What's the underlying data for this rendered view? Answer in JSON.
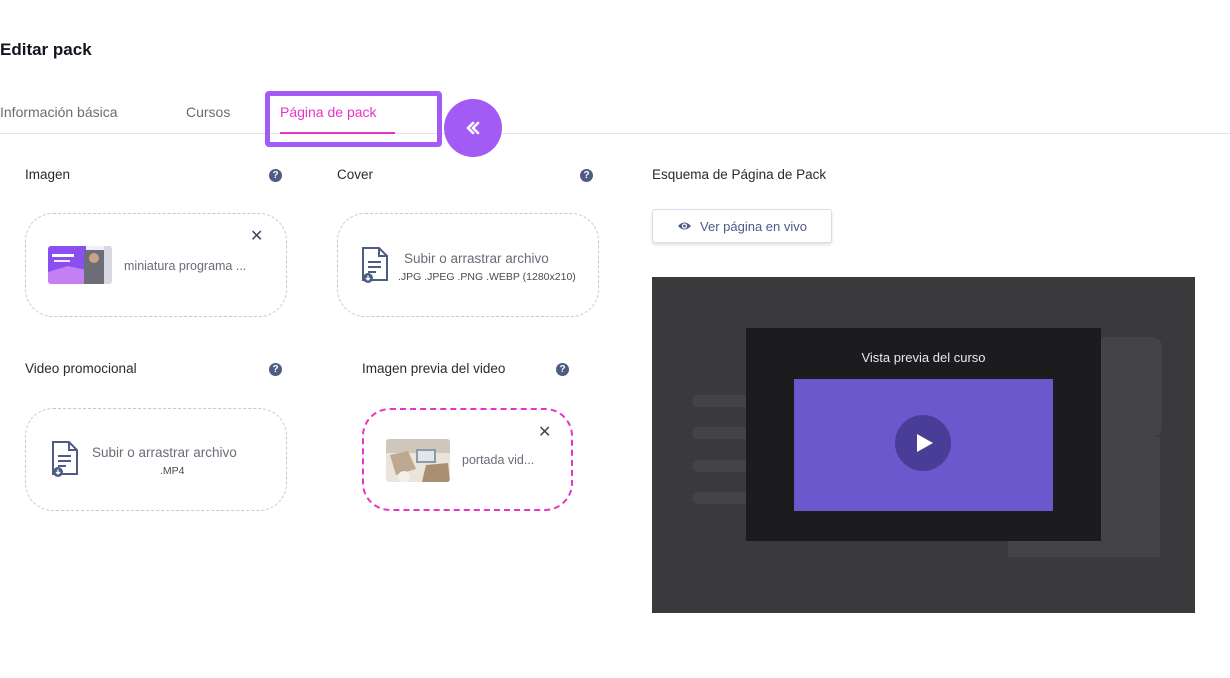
{
  "page": {
    "title": "Editar pack"
  },
  "tabs": {
    "basic": "Información básica",
    "courses": "Cursos",
    "pack_page": "Página de pack",
    "active": "pack_page"
  },
  "fields": {
    "image": {
      "label": "Imagen",
      "file_name": "miniatura programa ..."
    },
    "cover": {
      "label": "Cover",
      "upload_text": "Subir o arrastrar archivo",
      "formats": ".JPG .JPEG .PNG .WEBP (1280x210)"
    },
    "promo_video": {
      "label": "Video promocional",
      "upload_text": "Subir o arrastrar archivo",
      "formats": ".MP4"
    },
    "video_preview_image": {
      "label": "Imagen previa del video",
      "file_name": "portada vid..."
    }
  },
  "schema": {
    "label": "Esquema de Página de Pack",
    "live_button": "Ver página en vivo",
    "preview_title": "Vista previa del curso"
  },
  "icons": {
    "help": "question-circle-icon",
    "close": "close-icon",
    "file": "file-document-icon",
    "eye": "eye-icon",
    "play": "play-icon",
    "collapse": "chevron-left-icon"
  },
  "colors": {
    "accent_pink": "#e534c8",
    "highlight_purple": "#a25bf5",
    "video_purple": "#6a58cc",
    "icon_navy": "#4d5c82"
  }
}
